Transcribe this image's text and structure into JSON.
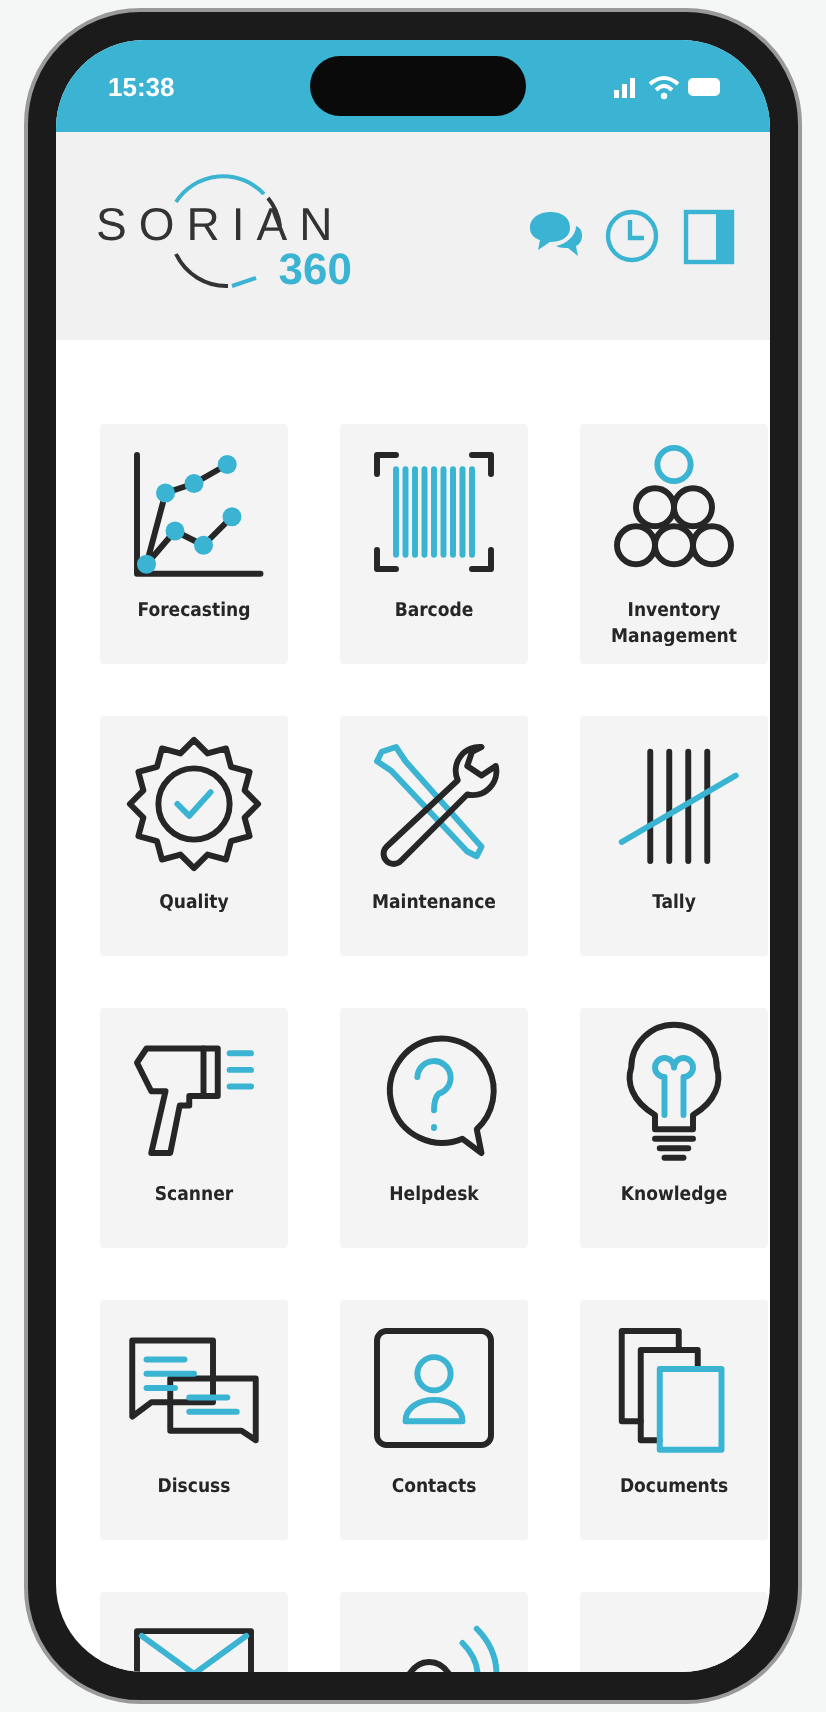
{
  "status_bar": {
    "time": "15:38"
  },
  "header": {
    "logo_word": "SORIAN",
    "logo_number": "360"
  },
  "tiles": [
    {
      "kind": "forecasting",
      "label": "Forecasting"
    },
    {
      "kind": "barcode",
      "label": "Barcode"
    },
    {
      "kind": "inventory",
      "label": "Inventory Management"
    },
    {
      "kind": "quality",
      "label": "Quality"
    },
    {
      "kind": "maintenance",
      "label": "Maintenance"
    },
    {
      "kind": "tally",
      "label": "Tally"
    },
    {
      "kind": "scanner",
      "label": "Scanner"
    },
    {
      "kind": "helpdesk",
      "label": "Helpdesk"
    },
    {
      "kind": "knowledge",
      "label": "Knowledge"
    },
    {
      "kind": "discuss",
      "label": "Discuss"
    },
    {
      "kind": "contacts",
      "label": "Contacts"
    },
    {
      "kind": "documents",
      "label": "Documents"
    },
    {
      "kind": "mail"
    },
    {
      "kind": "alert"
    },
    {
      "kind": "blank"
    }
  ]
}
